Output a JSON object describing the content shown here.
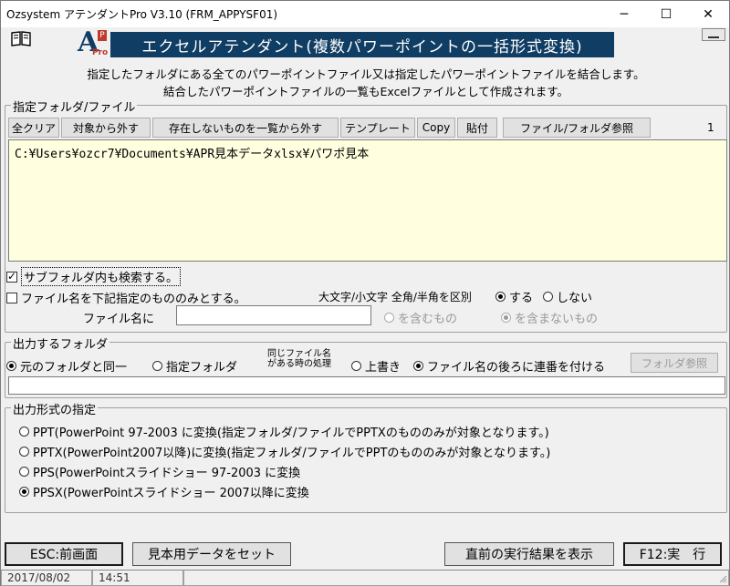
{
  "window": {
    "title": "Ozsystem アテンダントPro V3.10 (FRM_APPYSF01)"
  },
  "banner": {
    "title": "エクセルアテンダント(複数パワーポイントの一括形式変換)",
    "logo_letter": "A",
    "logo_sub": "Pro",
    "logo_badge": "P"
  },
  "description": {
    "line1": "指定したフォルダにある全てのパワーポイントファイル又は指定したパワーポイントファイルを結合します。",
    "line2": "結合したパワーポイントファイルの一覧もExcelファイルとして作成されます。"
  },
  "source_group": {
    "label": "指定フォルダ/ファイル",
    "buttons": [
      "全クリア",
      "対象から外す",
      "存在しないものを一覧から外す",
      "テンプレート",
      "Copy",
      "貼付",
      "ファイル/フォルダ参照"
    ],
    "count": "1",
    "path": "C:¥Users¥ozcr7¥Documents¥APR見本データxlsx¥パワポ見本",
    "subfolder_label": "サブフォルダ内も検索する。",
    "subfolder_checked": true,
    "filename_only_label": "ファイル名を下記指定のもののみとする。",
    "filename_only_checked": false,
    "case_label": "大文字/小文字 全角/半角を区別",
    "case_yes": "する",
    "case_no": "しない",
    "filename_label": "ファイル名に",
    "filename_value": "",
    "contains": "を含むもの",
    "not_contains": "を含まないもの"
  },
  "output_folder": {
    "label": "出力するフォルダ",
    "same_folder": "元のフォルダと同一",
    "specified_folder": "指定フォルダ",
    "same_name_line1": "同じファイル名",
    "same_name_line2": "がある時の処理",
    "overwrite": "上書き",
    "append_number": "ファイル名の後ろに連番を付ける",
    "browse": "フォルダ参照",
    "path_value": ""
  },
  "output_format": {
    "label": "出力形式の指定",
    "options": [
      "PPT(PowerPoint 97-2003 に変換(指定フォルダ/ファイルでPPTXのもののみが対象となります。)",
      "PPTX(PowerPoint2007以降)に変換(指定フォルダ/ファイルでPPTのもののみが対象となります。)",
      "PPS(PowerPointスライドショー 97-2003 に変換",
      "PPSX(PowerPointスライドショー 2007以降に変換"
    ],
    "selected_index": 3
  },
  "footer": {
    "esc": "ESC:前画面",
    "sample": "見本用データをセット",
    "last_result": "直前の実行結果を表示",
    "run": "F12:実　行"
  },
  "status": {
    "date": "2017/08/02",
    "time": "14:51"
  }
}
